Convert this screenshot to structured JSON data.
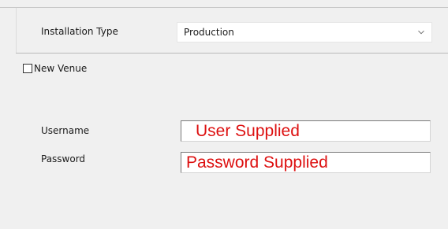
{
  "installation_type": {
    "label": "Installation Type",
    "value": "Production"
  },
  "new_venue": {
    "label": "New Venue",
    "checked": false
  },
  "username": {
    "label": "Username",
    "value": "User Supplied"
  },
  "password": {
    "label": "Password",
    "value": "Password Supplied"
  },
  "colors": {
    "field_text": "#dd1010",
    "background": "#f0f0f0"
  },
  "icons": {
    "dropdown": "chevron-down-icon"
  }
}
